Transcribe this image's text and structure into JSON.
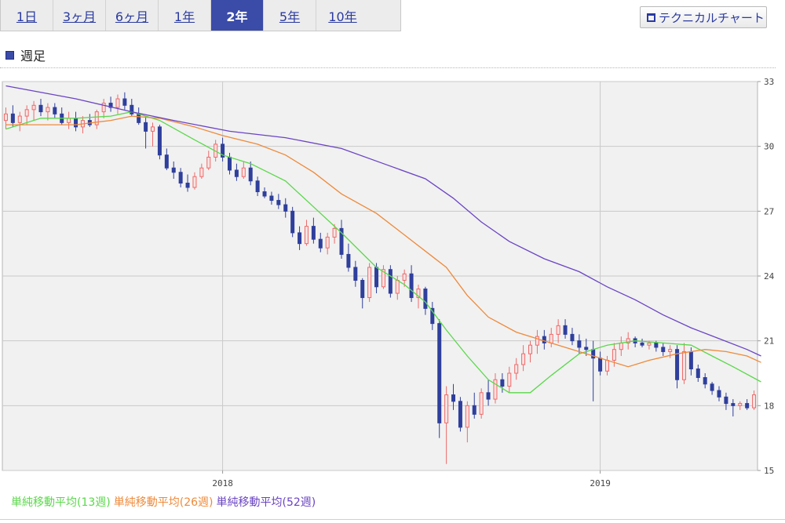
{
  "tabs": [
    {
      "label": "1日",
      "active": false
    },
    {
      "label": "3ヶ月",
      "active": false
    },
    {
      "label": "6ヶ月",
      "active": false
    },
    {
      "label": "1年",
      "active": false
    },
    {
      "label": "2年",
      "active": true
    },
    {
      "label": "5年",
      "active": false
    },
    {
      "label": "10年",
      "active": false
    }
  ],
  "technical_chart_label": "テクニカルチャート",
  "section_title": "週足",
  "colors": {
    "up": "#ee6a6a",
    "down": "#2f3f9c",
    "ma13": "#5ad84a",
    "ma26": "#ee8a3a",
    "ma52": "#6a44c4",
    "accent": "#3a4ba8"
  },
  "legend": [
    {
      "label": "単純移動平均(13週)",
      "color": "#5ad84a"
    },
    {
      "label": "単純移動平均(26週)",
      "color": "#ee8a3a"
    },
    {
      "label": "単純移動平均(52週)",
      "color": "#6a44c4"
    }
  ],
  "chart_data": {
    "type": "candlestick",
    "y_axis": {
      "ticks": [
        33,
        30,
        27,
        24,
        21,
        18,
        15
      ],
      "ylim": [
        15,
        33
      ],
      "position": "right"
    },
    "x_axis": {
      "ticks": [
        {
          "label": "2018",
          "index": 31
        },
        {
          "label": "2019",
          "index": 85
        }
      ]
    },
    "grid": true,
    "candles": [
      [
        31.2,
        31.8,
        30.8,
        31.5
      ],
      [
        31.5,
        31.9,
        30.9,
        31.1
      ],
      [
        31.1,
        31.6,
        30.7,
        31.4
      ],
      [
        31.4,
        31.9,
        31.0,
        31.7
      ],
      [
        31.7,
        32.1,
        31.2,
        31.9
      ],
      [
        31.9,
        32.2,
        31.4,
        31.6
      ],
      [
        31.6,
        32.0,
        31.2,
        31.8
      ],
      [
        31.8,
        32.0,
        31.3,
        31.5
      ],
      [
        31.5,
        31.8,
        31.0,
        31.1
      ],
      [
        31.1,
        31.6,
        30.8,
        31.3
      ],
      [
        31.3,
        31.6,
        30.7,
        30.9
      ],
      [
        30.9,
        31.4,
        30.6,
        31.2
      ],
      [
        31.2,
        31.5,
        30.9,
        31.0
      ],
      [
        31.0,
        31.7,
        30.8,
        31.6
      ],
      [
        31.6,
        32.2,
        31.3,
        32.0
      ],
      [
        32.0,
        32.3,
        31.6,
        31.8
      ],
      [
        31.8,
        32.4,
        31.5,
        32.2
      ],
      [
        32.2,
        32.5,
        31.7,
        31.9
      ],
      [
        31.9,
        32.2,
        31.4,
        31.5
      ],
      [
        31.5,
        31.8,
        31.0,
        31.1
      ],
      [
        31.1,
        31.4,
        29.9,
        30.7
      ],
      [
        30.7,
        31.1,
        30.0,
        30.9
      ],
      [
        30.9,
        31.0,
        29.4,
        29.6
      ],
      [
        29.6,
        29.9,
        28.9,
        29.0
      ],
      [
        29.0,
        29.3,
        28.5,
        28.8
      ],
      [
        28.8,
        29.0,
        28.1,
        28.3
      ],
      [
        28.3,
        28.7,
        27.9,
        28.1
      ],
      [
        28.1,
        28.8,
        28.0,
        28.6
      ],
      [
        28.6,
        29.2,
        28.5,
        29.0
      ],
      [
        29.0,
        29.8,
        28.9,
        29.5
      ],
      [
        29.5,
        30.3,
        29.3,
        30.1
      ],
      [
        30.1,
        30.4,
        29.3,
        29.5
      ],
      [
        29.5,
        29.7,
        28.7,
        28.9
      ],
      [
        28.9,
        29.2,
        28.4,
        28.6
      ],
      [
        28.6,
        29.3,
        28.5,
        29.0
      ],
      [
        29.0,
        29.3,
        28.2,
        28.4
      ],
      [
        28.4,
        28.6,
        27.7,
        27.9
      ],
      [
        27.9,
        28.1,
        27.6,
        27.7
      ],
      [
        27.7,
        27.9,
        27.3,
        27.5
      ],
      [
        27.5,
        27.8,
        27.1,
        27.3
      ],
      [
        27.3,
        27.6,
        26.7,
        27.0
      ],
      [
        27.0,
        27.2,
        25.8,
        26.0
      ],
      [
        26.0,
        26.3,
        25.2,
        25.5
      ],
      [
        25.5,
        26.6,
        25.4,
        26.3
      ],
      [
        26.3,
        26.7,
        25.5,
        25.7
      ],
      [
        25.7,
        26.0,
        25.1,
        25.3
      ],
      [
        25.3,
        26.0,
        25.0,
        25.8
      ],
      [
        25.8,
        26.4,
        25.5,
        26.2
      ],
      [
        26.2,
        26.6,
        24.8,
        25.0
      ],
      [
        25.0,
        25.5,
        24.2,
        24.4
      ],
      [
        24.4,
        24.7,
        23.5,
        23.8
      ],
      [
        23.8,
        23.9,
        22.5,
        23.0
      ],
      [
        23.0,
        24.6,
        22.8,
        24.4
      ],
      [
        24.4,
        24.6,
        23.2,
        23.5
      ],
      [
        23.5,
        24.5,
        23.4,
        24.3
      ],
      [
        24.3,
        24.5,
        23.0,
        23.2
      ],
      [
        23.2,
        24.0,
        22.9,
        23.8
      ],
      [
        23.8,
        24.3,
        23.5,
        24.1
      ],
      [
        24.1,
        24.5,
        22.8,
        23.0
      ],
      [
        23.0,
        23.6,
        22.5,
        23.4
      ],
      [
        23.4,
        23.5,
        22.2,
        22.5
      ],
      [
        22.5,
        22.8,
        21.5,
        21.8
      ],
      [
        21.8,
        22.0,
        16.5,
        17.2
      ],
      [
        17.2,
        18.9,
        15.3,
        18.5
      ],
      [
        18.5,
        19.0,
        17.8,
        18.2
      ],
      [
        18.2,
        18.4,
        16.8,
        17.0
      ],
      [
        17.0,
        18.2,
        16.3,
        18.0
      ],
      [
        18.0,
        18.6,
        17.4,
        17.6
      ],
      [
        17.6,
        18.8,
        17.4,
        18.6
      ],
      [
        18.6,
        19.2,
        18.0,
        18.3
      ],
      [
        18.3,
        19.5,
        18.1,
        19.2
      ],
      [
        19.2,
        19.5,
        18.6,
        18.9
      ],
      [
        18.9,
        19.8,
        18.6,
        19.5
      ],
      [
        19.5,
        20.2,
        19.2,
        19.9
      ],
      [
        19.9,
        20.8,
        19.6,
        20.4
      ],
      [
        20.4,
        21.0,
        20.0,
        20.8
      ],
      [
        20.8,
        21.5,
        20.4,
        21.2
      ],
      [
        21.2,
        21.5,
        20.6,
        20.9
      ],
      [
        20.9,
        21.6,
        20.7,
        21.3
      ],
      [
        21.3,
        22.0,
        20.9,
        21.7
      ],
      [
        21.7,
        22.0,
        21.1,
        21.3
      ],
      [
        21.3,
        21.6,
        20.8,
        21.0
      ],
      [
        21.0,
        21.3,
        20.4,
        20.7
      ],
      [
        20.7,
        21.1,
        20.3,
        20.6
      ],
      [
        20.6,
        21.0,
        18.2,
        20.2
      ],
      [
        20.2,
        20.5,
        19.4,
        19.6
      ],
      [
        19.6,
        20.3,
        19.4,
        20.1
      ],
      [
        20.1,
        20.9,
        19.8,
        20.6
      ],
      [
        20.6,
        21.2,
        20.3,
        20.9
      ],
      [
        20.9,
        21.4,
        20.6,
        21.1
      ],
      [
        21.1,
        21.2,
        20.7,
        20.9
      ],
      [
        20.9,
        21.1,
        20.7,
        20.8
      ],
      [
        20.8,
        21.0,
        20.6,
        20.9
      ],
      [
        20.9,
        21.0,
        20.5,
        20.7
      ],
      [
        20.7,
        20.9,
        20.3,
        20.5
      ],
      [
        20.5,
        20.8,
        20.2,
        20.6
      ],
      [
        20.6,
        20.8,
        18.8,
        19.2
      ],
      [
        19.2,
        20.9,
        19.0,
        20.5
      ],
      [
        20.5,
        20.7,
        19.4,
        19.7
      ],
      [
        19.7,
        19.9,
        19.1,
        19.3
      ],
      [
        19.3,
        19.5,
        18.8,
        19.0
      ],
      [
        19.0,
        19.1,
        18.5,
        18.7
      ],
      [
        18.7,
        18.9,
        18.2,
        18.4
      ],
      [
        18.4,
        18.6,
        17.8,
        18.1
      ],
      [
        18.1,
        18.3,
        17.5,
        18.0
      ],
      [
        18.0,
        18.2,
        17.8,
        18.1
      ],
      [
        18.1,
        18.3,
        17.8,
        17.9
      ],
      [
        17.9,
        18.7,
        17.8,
        18.5
      ]
    ],
    "series": [
      {
        "name": "単純移動平均(13週)",
        "key": "ma13",
        "points": [
          [
            0,
            30.8
          ],
          [
            5,
            31.3
          ],
          [
            10,
            31.3
          ],
          [
            15,
            31.4
          ],
          [
            18,
            31.6
          ],
          [
            22,
            31.2
          ],
          [
            27,
            30.3
          ],
          [
            31,
            29.6
          ],
          [
            35,
            29.2
          ],
          [
            40,
            28.4
          ],
          [
            44,
            27.2
          ],
          [
            48,
            26.0
          ],
          [
            53,
            24.4
          ],
          [
            57,
            23.6
          ],
          [
            60,
            22.8
          ],
          [
            63,
            21.5
          ],
          [
            66,
            20.3
          ],
          [
            69,
            19.2
          ],
          [
            72,
            18.6
          ],
          [
            75,
            18.6
          ],
          [
            78,
            19.4
          ],
          [
            82,
            20.4
          ],
          [
            86,
            20.8
          ],
          [
            90,
            21.0
          ],
          [
            94,
            20.9
          ],
          [
            98,
            20.8
          ],
          [
            101,
            20.3
          ],
          [
            104,
            19.8
          ],
          [
            108,
            19.1
          ]
        ]
      },
      {
        "name": "単純移動平均(26週)",
        "key": "ma26",
        "points": [
          [
            0,
            31.0
          ],
          [
            5,
            31.0
          ],
          [
            10,
            31.0
          ],
          [
            15,
            31.2
          ],
          [
            18,
            31.4
          ],
          [
            22,
            31.3
          ],
          [
            27,
            30.9
          ],
          [
            31,
            30.5
          ],
          [
            36,
            30.1
          ],
          [
            40,
            29.6
          ],
          [
            44,
            28.8
          ],
          [
            48,
            27.8
          ],
          [
            53,
            26.9
          ],
          [
            57,
            25.9
          ],
          [
            61,
            24.9
          ],
          [
            63,
            24.4
          ],
          [
            66,
            23.1
          ],
          [
            69,
            22.1
          ],
          [
            73,
            21.4
          ],
          [
            77,
            21.0
          ],
          [
            81,
            20.6
          ],
          [
            85,
            20.2
          ],
          [
            89,
            19.8
          ],
          [
            92,
            20.1
          ],
          [
            96,
            20.4
          ],
          [
            100,
            20.6
          ],
          [
            103,
            20.5
          ],
          [
            106,
            20.3
          ],
          [
            108,
            20.0
          ]
        ]
      },
      {
        "name": "単純移動平均(52週)",
        "key": "ma52",
        "points": [
          [
            0,
            32.8
          ],
          [
            10,
            32.2
          ],
          [
            18,
            31.6
          ],
          [
            24,
            31.2
          ],
          [
            32,
            30.7
          ],
          [
            40,
            30.4
          ],
          [
            48,
            29.9
          ],
          [
            54,
            29.2
          ],
          [
            60,
            28.5
          ],
          [
            64,
            27.6
          ],
          [
            68,
            26.5
          ],
          [
            72,
            25.6
          ],
          [
            77,
            24.8
          ],
          [
            82,
            24.2
          ],
          [
            86,
            23.5
          ],
          [
            90,
            22.9
          ],
          [
            94,
            22.2
          ],
          [
            98,
            21.6
          ],
          [
            102,
            21.1
          ],
          [
            106,
            20.6
          ],
          [
            108,
            20.3
          ]
        ]
      }
    ]
  }
}
